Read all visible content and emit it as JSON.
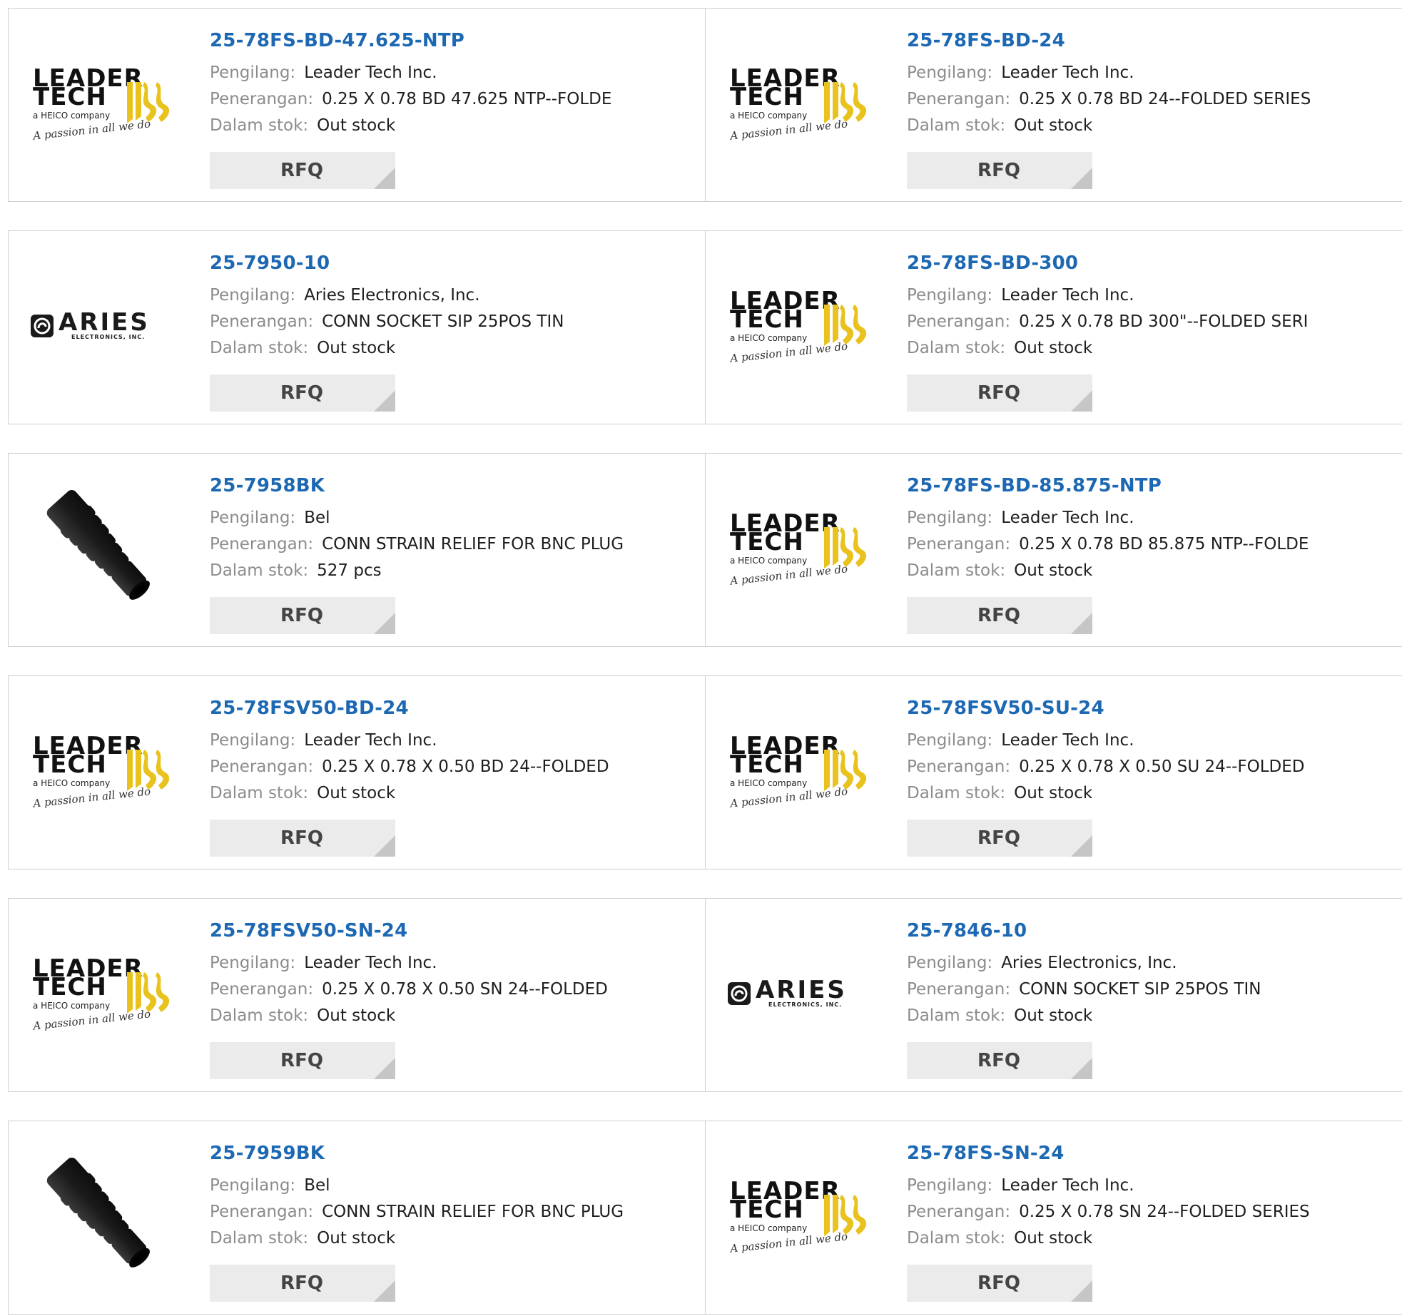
{
  "labels": {
    "manufacturer": "Pengilang:",
    "description": "Penerangan:",
    "stock": "Dalam stok:",
    "rfq": "RFQ"
  },
  "logos": {
    "leader_tech": {
      "line1": "LEADER",
      "line2": "TECH",
      "subtitle": "a HEICO company",
      "tagline": "A passion in all we do"
    },
    "aries": {
      "name": "ARIES",
      "subtitle": "ELECTRONICS, INC."
    }
  },
  "colors": {
    "link": "#1d68b3",
    "label": "#8c8c8c",
    "logo_yellow": "#e9c21e",
    "button_bg": "#ebebeb",
    "button_corner": "#c6c6c6"
  },
  "products": [
    {
      "part": "25-78FS-BD-47.625-NTP",
      "manufacturer": "Leader Tech Inc.",
      "description": "0.25 X 0.78 BD 47.625 NTP--FOLDE",
      "stock": "Out stock",
      "image": "leader-tech-logo"
    },
    {
      "part": "25-78FS-BD-24",
      "manufacturer": "Leader Tech Inc.",
      "description": "0.25 X 0.78 BD 24--FOLDED SERIES",
      "stock": "Out stock",
      "image": "leader-tech-logo"
    },
    {
      "part": "25-7950-10",
      "manufacturer": "Aries Electronics, Inc.",
      "description": "CONN SOCKET SIP 25POS TIN",
      "stock": "Out stock",
      "image": "aries-logo"
    },
    {
      "part": "25-78FS-BD-300",
      "manufacturer": "Leader Tech Inc.",
      "description": "0.25 X 0.78 BD 300\"--FOLDED SERI",
      "stock": "Out stock",
      "image": "leader-tech-logo"
    },
    {
      "part": "25-7958BK",
      "manufacturer": "Bel",
      "description": "CONN STRAIN RELIEF FOR BNC PLUG",
      "stock": "527 pcs",
      "image": "strain-relief-boot-photo"
    },
    {
      "part": "25-78FS-BD-85.875-NTP",
      "manufacturer": "Leader Tech Inc.",
      "description": "0.25 X 0.78 BD 85.875 NTP--FOLDE",
      "stock": "Out stock",
      "image": "leader-tech-logo"
    },
    {
      "part": "25-78FSV50-BD-24",
      "manufacturer": "Leader Tech Inc.",
      "description": "0.25 X 0.78 X 0.50 BD 24--FOLDED",
      "stock": "Out stock",
      "image": "leader-tech-logo"
    },
    {
      "part": "25-78FSV50-SU-24",
      "manufacturer": "Leader Tech Inc.",
      "description": "0.25 X 0.78 X 0.50 SU 24--FOLDED",
      "stock": "Out stock",
      "image": "leader-tech-logo"
    },
    {
      "part": "25-78FSV50-SN-24",
      "manufacturer": "Leader Tech Inc.",
      "description": "0.25 X 0.78 X 0.50 SN 24--FOLDED",
      "stock": "Out stock",
      "image": "leader-tech-logo"
    },
    {
      "part": "25-7846-10",
      "manufacturer": "Aries Electronics, Inc.",
      "description": "CONN SOCKET SIP 25POS TIN",
      "stock": "Out stock",
      "image": "aries-logo"
    },
    {
      "part": "25-7959BK",
      "manufacturer": "Bel",
      "description": "CONN STRAIN RELIEF FOR BNC PLUG",
      "stock": "Out stock",
      "image": "strain-relief-boot-photo"
    },
    {
      "part": "25-78FS-SN-24",
      "manufacturer": "Leader Tech Inc.",
      "description": "0.25 X 0.78 SN 24--FOLDED SERIES",
      "stock": "Out stock",
      "image": "leader-tech-logo"
    }
  ]
}
